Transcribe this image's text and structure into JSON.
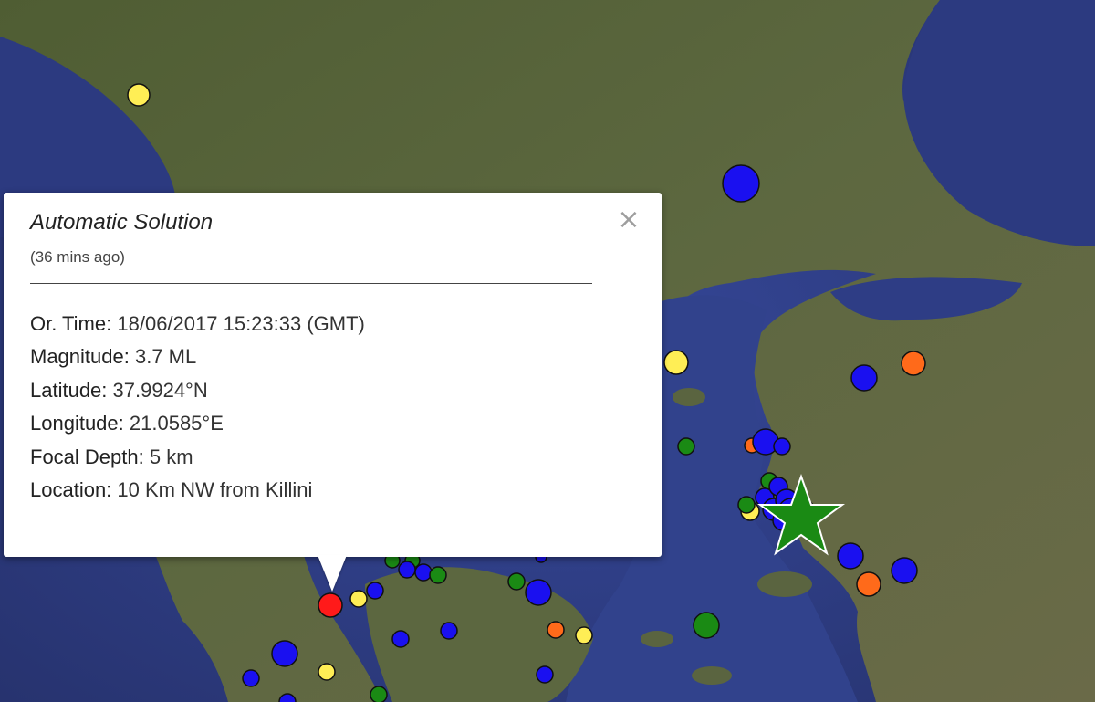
{
  "map": {
    "colors": {
      "sea": "#2f3f86",
      "land": "#55603a",
      "red": "#ff1a1a",
      "blue": "#1a10f0",
      "yellow": "#ffee55",
      "orange": "#ff6a1a",
      "green": "#1a8a14"
    },
    "epicenter_marker": "red-circle",
    "large_event_marker": "green-star-icon"
  },
  "popup": {
    "title": "Automatic Solution",
    "subtitle": "(36 mins ago)",
    "close_icon": "×",
    "fields": [
      {
        "label": "Or. Time:",
        "value": "18/06/2017  15:23:33 (GMT)"
      },
      {
        "label": "Magnitude:",
        "value": "3.7 ML"
      },
      {
        "label": "Latitude:",
        "value": "37.9924°N"
      },
      {
        "label": "Longitude:",
        "value": "21.0585°E"
      },
      {
        "label": "Focal Depth:",
        "value": "5 km"
      },
      {
        "label": "Location:",
        "value": "10 Km NW from Killini"
      }
    ]
  }
}
